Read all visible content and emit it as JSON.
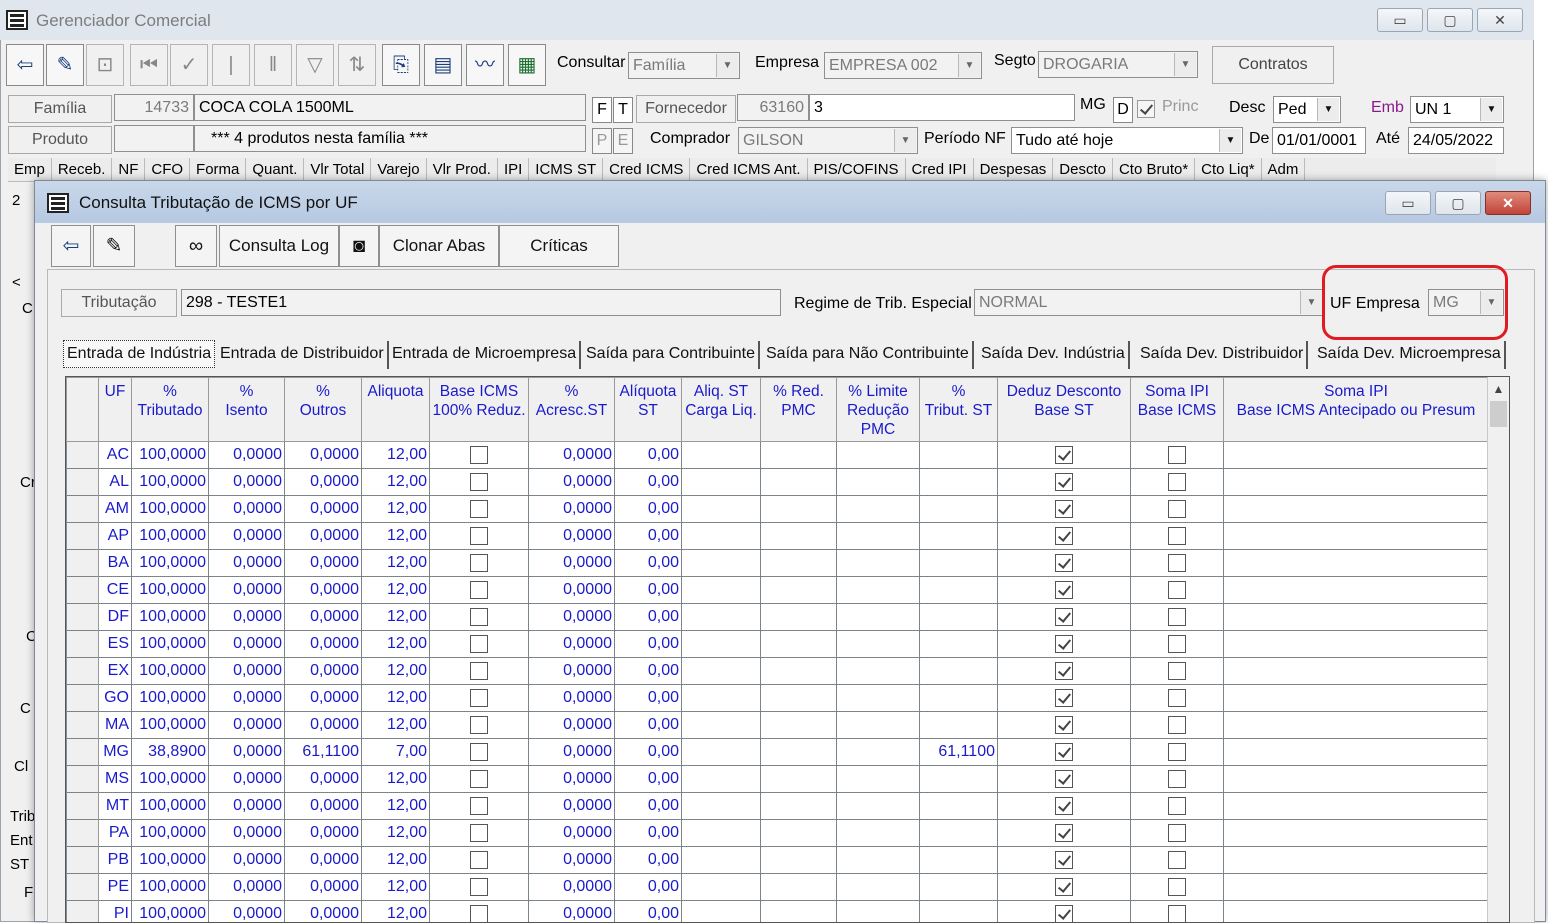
{
  "main": {
    "title": "Gerenciador Comercial",
    "window_buttons": [
      "▭",
      "▢",
      "✕"
    ],
    "consultar_label": "Consultar",
    "consultar_value": "Família",
    "empresa_label": "Empresa",
    "empresa_value": "EMPRESA 002",
    "segto_label": "Segto",
    "segto_value": "DROGARIA",
    "contratos_label": "Contratos",
    "familia_btn": "Família",
    "familia_code": "14733",
    "familia_name": "COCA COLA 1500ML",
    "f_label": "F",
    "t_label": "T",
    "fornecedor_btn": "Fornecedor",
    "fornecedor_code": "63160",
    "fornecedor_name": "3",
    "mg_label": "MG",
    "d_label": "D",
    "princ_label": "Princ",
    "desc_label": "Desc",
    "desc_value": "Ped",
    "emb_label": "Emb",
    "emb_value": "UN 1",
    "produto_btn": "Produto",
    "produto_info": "*** 4 produtos nesta família ***",
    "p_label": "P",
    "e_label": "E",
    "comprador_label": "Comprador",
    "comprador_value": "GILSON",
    "periodo_label": "Período NF",
    "periodo_value": "Tudo até hoje",
    "de_label": "De",
    "de_value": "01/01/0001",
    "ate_label": "Até",
    "ate_value": "24/05/2022",
    "grid_headers": [
      "Emp",
      "Receb.",
      "NF",
      "CFO",
      "Forma",
      "Quant.",
      "Vlr Total",
      "Varejo",
      "Vlr Prod.",
      "IPI",
      "ICMS ST",
      "Cred ICMS",
      "Cred ICMS Ant.",
      "PIS/COFINS",
      "Cred IPI",
      "Despesas",
      "Descto",
      "Cto Bruto*",
      "Cto Liq*",
      "Adm"
    ],
    "left_strip": [
      "2",
      "",
      "",
      "<",
      "C",
      "",
      "",
      "",
      "",
      "Cr",
      "",
      "",
      "C",
      "",
      "C",
      "Cl",
      "Trib",
      "Ent",
      "ST",
      "F"
    ]
  },
  "dialog": {
    "title": "Consulta Tributação de ICMS por UF",
    "toolbar": {
      "consulta_log": "Consulta Log",
      "clonar_abas": "Clonar Abas",
      "criticas": "Críticas"
    },
    "tributacao_btn": "Tributação",
    "tributacao_value": "298  -  TESTE1",
    "regime_label": "Regime de Trib. Especial",
    "regime_value": "NORMAL",
    "uf_empresa_label": "UF Empresa",
    "uf_empresa_value": "MG",
    "tabs": [
      "Entrada de Indústria",
      "Entrada de Distribuidor",
      "Entrada de Microempresa",
      "Saída para Contribuinte",
      "Saída para Não Contribuinte",
      "Saída Dev. Indústria",
      "Saída Dev. Distribuidor",
      "Saída Dev. Microempresa"
    ],
    "table": {
      "headers": [
        "UF",
        "%\nTributado",
        "%\nIsento",
        "%\nOutros",
        "Aliquota",
        "Base ICMS\n100% Reduz.",
        "%\nAcresc.ST",
        "Alíquota\nST",
        "Aliq. ST\nCarga Liq.",
        "% Red.\nPMC",
        "% Limite\nRedução\nPMC",
        "%\nTribut. ST",
        "Deduz Desconto\nBase ST",
        "Soma IPI\nBase ICMS",
        "Soma IPI\nBase ICMS Antecipado ou Presum"
      ],
      "rows": [
        [
          "AC",
          "100,0000",
          "0,0000",
          "0,0000",
          "12,00",
          false,
          "0,0000",
          "0,00",
          "",
          "",
          "",
          "",
          true,
          false
        ],
        [
          "AL",
          "100,0000",
          "0,0000",
          "0,0000",
          "12,00",
          false,
          "0,0000",
          "0,00",
          "",
          "",
          "",
          "",
          true,
          false
        ],
        [
          "AM",
          "100,0000",
          "0,0000",
          "0,0000",
          "12,00",
          false,
          "0,0000",
          "0,00",
          "",
          "",
          "",
          "",
          true,
          false
        ],
        [
          "AP",
          "100,0000",
          "0,0000",
          "0,0000",
          "12,00",
          false,
          "0,0000",
          "0,00",
          "",
          "",
          "",
          "",
          true,
          false
        ],
        [
          "BA",
          "100,0000",
          "0,0000",
          "0,0000",
          "12,00",
          false,
          "0,0000",
          "0,00",
          "",
          "",
          "",
          "",
          true,
          false
        ],
        [
          "CE",
          "100,0000",
          "0,0000",
          "0,0000",
          "12,00",
          false,
          "0,0000",
          "0,00",
          "",
          "",
          "",
          "",
          true,
          false
        ],
        [
          "DF",
          "100,0000",
          "0,0000",
          "0,0000",
          "12,00",
          false,
          "0,0000",
          "0,00",
          "",
          "",
          "",
          "",
          true,
          false
        ],
        [
          "ES",
          "100,0000",
          "0,0000",
          "0,0000",
          "12,00",
          false,
          "0,0000",
          "0,00",
          "",
          "",
          "",
          "",
          true,
          false
        ],
        [
          "EX",
          "100,0000",
          "0,0000",
          "0,0000",
          "12,00",
          false,
          "0,0000",
          "0,00",
          "",
          "",
          "",
          "",
          true,
          false
        ],
        [
          "GO",
          "100,0000",
          "0,0000",
          "0,0000",
          "12,00",
          false,
          "0,0000",
          "0,00",
          "",
          "",
          "",
          "",
          true,
          false
        ],
        [
          "MA",
          "100,0000",
          "0,0000",
          "0,0000",
          "12,00",
          false,
          "0,0000",
          "0,00",
          "",
          "",
          "",
          "",
          true,
          false
        ],
        [
          "MG",
          "38,8900",
          "0,0000",
          "61,1100",
          "7,00",
          false,
          "0,0000",
          "0,00",
          "",
          "",
          "",
          "61,1100",
          true,
          false
        ],
        [
          "MS",
          "100,0000",
          "0,0000",
          "0,0000",
          "12,00",
          false,
          "0,0000",
          "0,00",
          "",
          "",
          "",
          "",
          true,
          false
        ],
        [
          "MT",
          "100,0000",
          "0,0000",
          "0,0000",
          "12,00",
          false,
          "0,0000",
          "0,00",
          "",
          "",
          "",
          "",
          true,
          false
        ],
        [
          "PA",
          "100,0000",
          "0,0000",
          "0,0000",
          "12,00",
          false,
          "0,0000",
          "0,00",
          "",
          "",
          "",
          "",
          true,
          false
        ],
        [
          "PB",
          "100,0000",
          "0,0000",
          "0,0000",
          "12,00",
          false,
          "0,0000",
          "0,00",
          "",
          "",
          "",
          "",
          true,
          false
        ],
        [
          "PE",
          "100,0000",
          "0,0000",
          "0,0000",
          "12,00",
          false,
          "0,0000",
          "0,00",
          "",
          "",
          "",
          "",
          true,
          false
        ],
        [
          "PI",
          "100,0000",
          "0,0000",
          "0,0000",
          "12,00",
          false,
          "0,0000",
          "0,00",
          "",
          "",
          "",
          "",
          true,
          false
        ]
      ]
    }
  }
}
